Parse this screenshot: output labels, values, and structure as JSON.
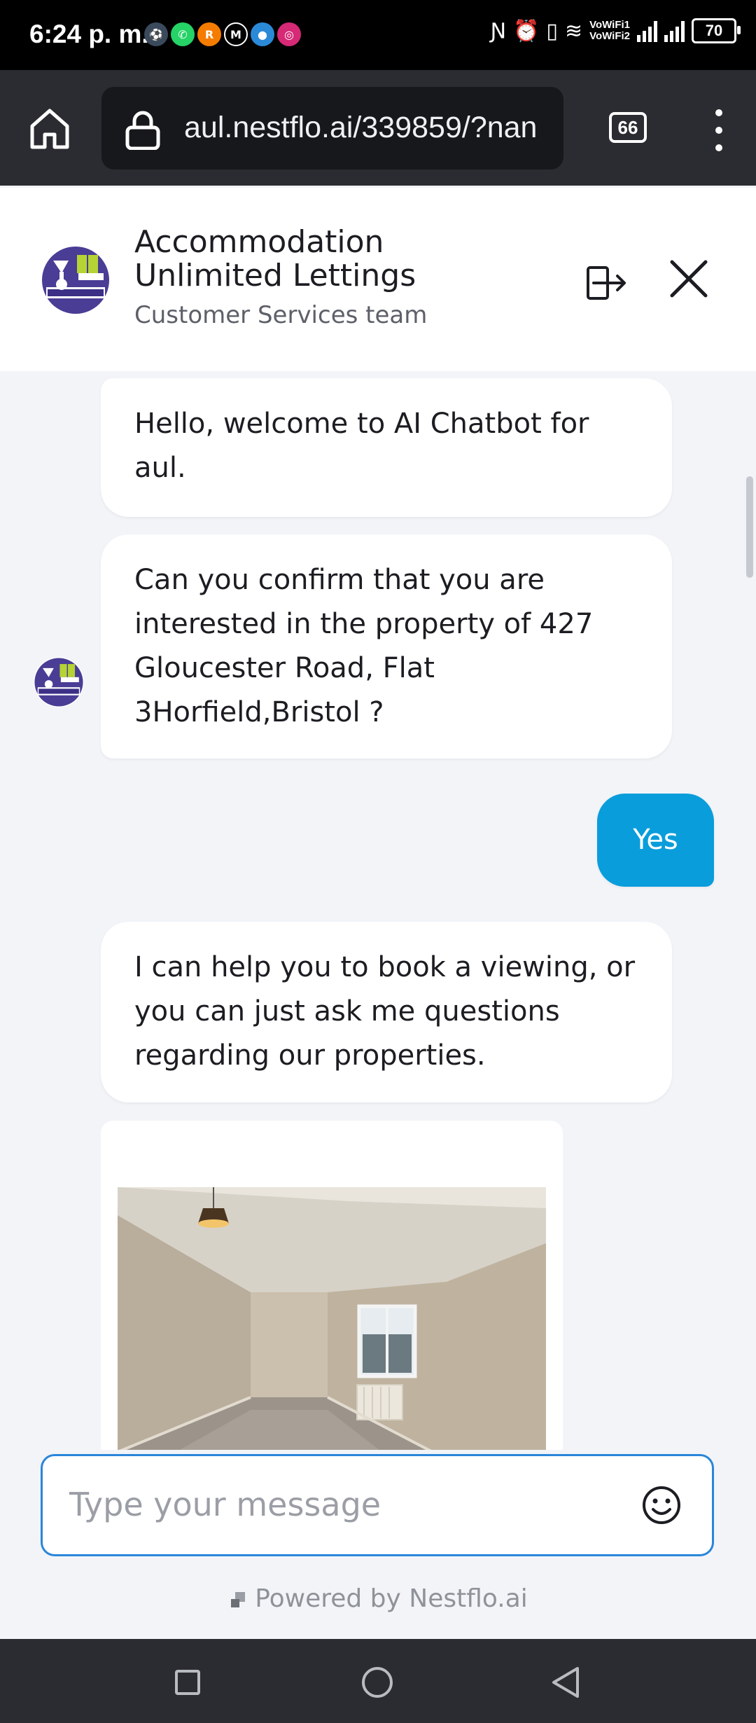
{
  "status_bar": {
    "time": "6:24 p. m.",
    "vowifi_1": "VoWiFi1",
    "vowifi_2": "VoWiFi2",
    "battery": "70",
    "app_icons": [
      "sport-icon",
      "whatsapp-icon",
      "rappi-icon",
      "gmail-icon",
      "game-icon",
      "instagram-icon"
    ],
    "system_icons": [
      "nfc-icon",
      "alarm-icon",
      "vibrate-icon",
      "wifi-icon",
      "signal-icon"
    ]
  },
  "browser": {
    "url": "aul.nestflo.ai/339859/?nan",
    "tab_count": "66"
  },
  "chat_header": {
    "company_name": "Accommodation Unlimited Lettings",
    "team": "Customer Services team"
  },
  "messages": [
    {
      "sender": "bot",
      "text": "Hello, welcome to AI Chatbot for aul."
    },
    {
      "sender": "bot",
      "text": "Can you confirm that you are interested in the property of 427 Gloucester Road, Flat 3Horfield,Bristol ?"
    },
    {
      "sender": "user",
      "text": "Yes"
    },
    {
      "sender": "bot",
      "text": "I can help you to book a viewing, or you can just ask me questions regarding our properties."
    }
  ],
  "input": {
    "placeholder": "Type your message"
  },
  "footer": {
    "powered_by": "Powered by Nestflo.ai"
  },
  "colors": {
    "user_bubble": "#0a9ddb",
    "input_border": "#2a86d9",
    "chat_background": "#f2f4f8",
    "browser_bar": "#2b2c31"
  }
}
